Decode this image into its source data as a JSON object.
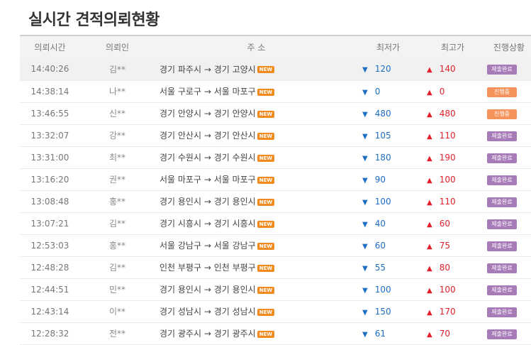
{
  "page": {
    "title": "실시간 견적의뢰현황"
  },
  "table": {
    "headers": [
      "의뢰시간",
      "의뢰인",
      "주 소",
      "최저가",
      "최고가",
      "진행상황"
    ],
    "new_label": "NEW",
    "low_marker": "▼",
    "high_marker": "▲",
    "rows": [
      {
        "time": "14:40:26",
        "name": "김**",
        "address": "경기 파주시 → 경기 고양시",
        "low": "120",
        "high": "140",
        "status": "제출완료"
      },
      {
        "time": "14:38:14",
        "name": "나**",
        "address": "서울 구로구 → 서울 마포구",
        "low": "0",
        "high": "0",
        "status": "진행중"
      },
      {
        "time": "13:46:55",
        "name": "신**",
        "address": "경기 안양시 → 경기 안양시",
        "low": "480",
        "high": "480",
        "status": "진행중"
      },
      {
        "time": "13:32:07",
        "name": "강**",
        "address": "경기 안산시 → 경기 안산시",
        "low": "105",
        "high": "110",
        "status": "제출완료"
      },
      {
        "time": "13:31:00",
        "name": "최**",
        "address": "경기 수원시 → 경기 수원시",
        "low": "180",
        "high": "190",
        "status": "제출완료"
      },
      {
        "time": "13:16:20",
        "name": "권**",
        "address": "서울 마포구 → 서울 마포구",
        "low": "90",
        "high": "100",
        "status": "제출완료"
      },
      {
        "time": "13:08:48",
        "name": "홍**",
        "address": "경기 용인시 → 경기 용인시",
        "low": "100",
        "high": "110",
        "status": "제출완료"
      },
      {
        "time": "13:07:21",
        "name": "김**",
        "address": "경기 시흥시 → 경기 시흥시",
        "low": "40",
        "high": "60",
        "status": "제출완료"
      },
      {
        "time": "12:53:03",
        "name": "홍**",
        "address": "서울 강남구 → 서울 강남구",
        "low": "60",
        "high": "75",
        "status": "제출완료"
      },
      {
        "time": "12:48:28",
        "name": "김**",
        "address": "인천 부평구 → 인천 부평구",
        "low": "55",
        "high": "80",
        "status": "제출완료"
      },
      {
        "time": "12:44:51",
        "name": "민**",
        "address": "경기 용인시 → 경기 용인시",
        "low": "100",
        "high": "100",
        "status": "제출완료"
      },
      {
        "time": "12:43:14",
        "name": "이**",
        "address": "경기 성남시 → 경기 성남시",
        "low": "150",
        "high": "170",
        "status": "제출완료"
      },
      {
        "time": "12:28:32",
        "name": "전**",
        "address": "경기 광주시 → 경기 광주시",
        "low": "61",
        "high": "70",
        "status": "제출완료"
      }
    ]
  },
  "colors": {
    "low": "#1d6fc4",
    "high": "#e2202c",
    "new_badge": "#f28a1d",
    "status_done": "#a77ab8",
    "status_progress": "#f4935a"
  }
}
